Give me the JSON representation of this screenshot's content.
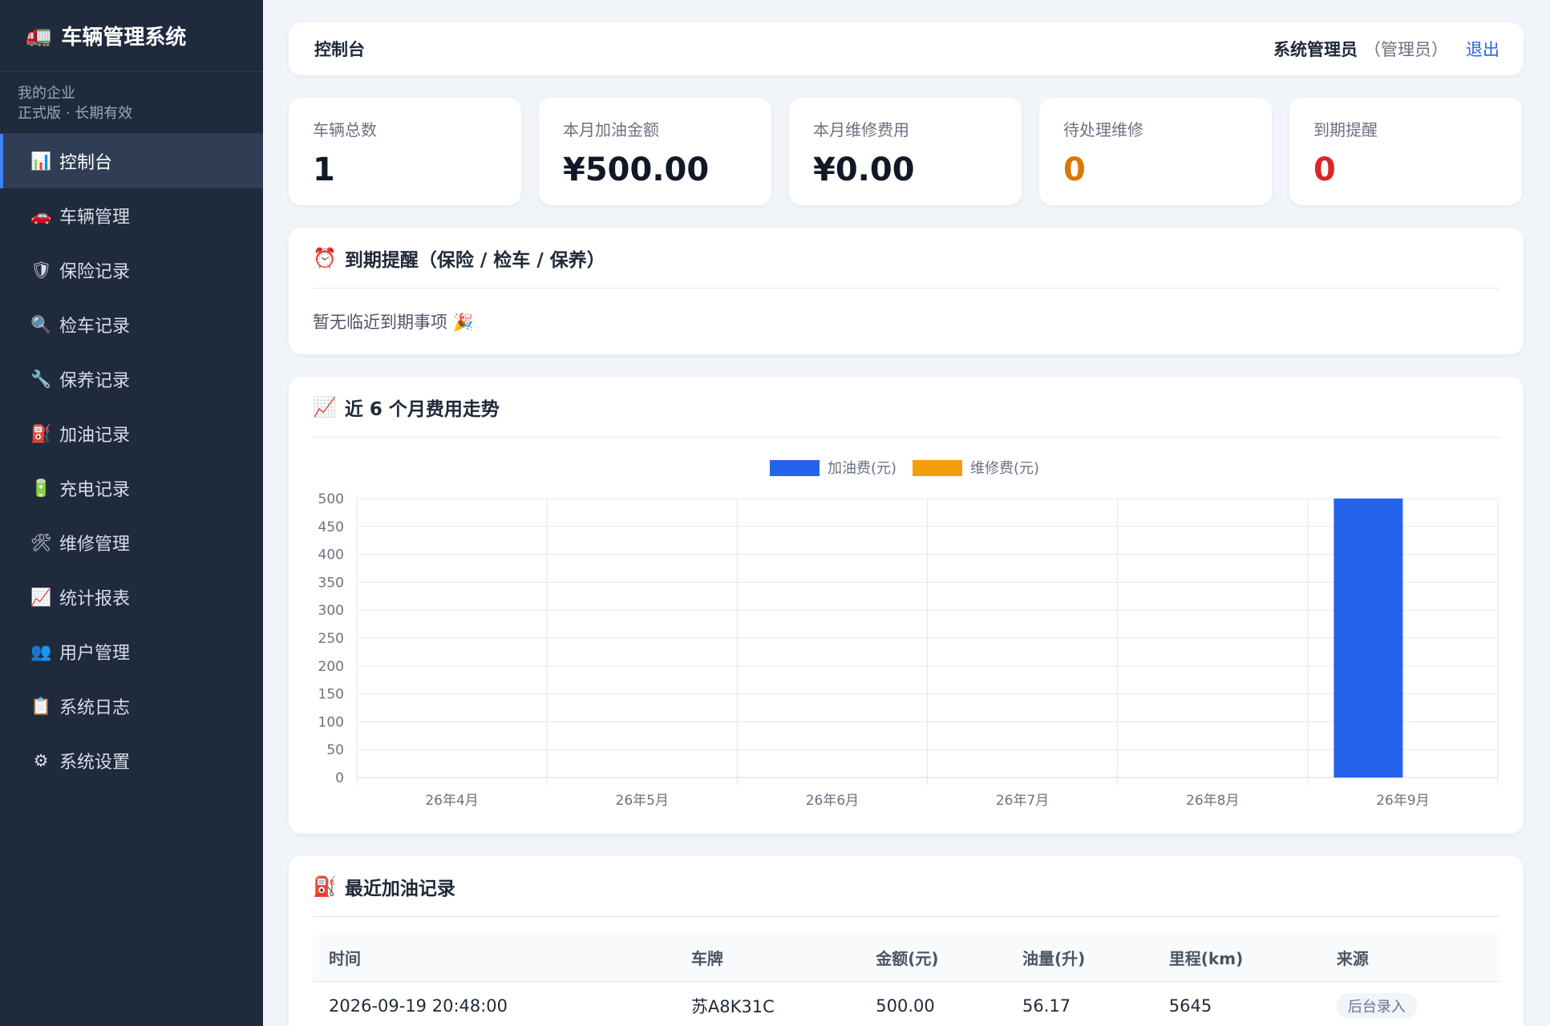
{
  "sidebar": {
    "brand_icon": "🚛",
    "brand_title": "车辆管理系统",
    "org_name": "我的企业",
    "org_plan": "正式版 · 长期有效",
    "items": [
      {
        "icon": "📊",
        "label": "控制台",
        "active": true
      },
      {
        "icon": "🚗",
        "label": "车辆管理"
      },
      {
        "icon": "🛡",
        "label": "保险记录"
      },
      {
        "icon": "🔍",
        "label": "检车记录"
      },
      {
        "icon": "🔧",
        "label": "保养记录"
      },
      {
        "icon": "⛽",
        "label": "加油记录"
      },
      {
        "icon": "🔋",
        "label": "充电记录"
      },
      {
        "icon": "🛠",
        "label": "维修管理"
      },
      {
        "icon": "📈",
        "label": "统计报表"
      },
      {
        "icon": "👥",
        "label": "用户管理"
      },
      {
        "icon": "📋",
        "label": "系统日志"
      },
      {
        "icon": "⚙",
        "label": "系统设置"
      }
    ]
  },
  "header": {
    "title": "控制台",
    "user_name": "系统管理员",
    "user_role": "（管理员）",
    "logout_label": "退出"
  },
  "stats": [
    {
      "label": "车辆总数",
      "value": "1"
    },
    {
      "label": "本月加油金额",
      "value": "¥500.00"
    },
    {
      "label": "本月维修费用",
      "value": "¥0.00"
    },
    {
      "label": "待处理维修",
      "value": "0",
      "color": "#d97706"
    },
    {
      "label": "到期提醒",
      "value": "0",
      "color": "#dc2626"
    }
  ],
  "reminder": {
    "icon": "⏰",
    "title": "到期提醒（保险 / 检车 / 保养）",
    "empty_text": "暂无临近到期事项 🎉"
  },
  "trend": {
    "icon": "📈",
    "title": "近 6 个月费用走势"
  },
  "chart_data": {
    "type": "bar",
    "categories": [
      "26年4月",
      "26年5月",
      "26年6月",
      "26年7月",
      "26年8月",
      "26年9月"
    ],
    "series": [
      {
        "name": "加油费(元)",
        "color": "#2563eb",
        "values": [
          0,
          0,
          0,
          0,
          0,
          500
        ]
      },
      {
        "name": "维修费(元)",
        "color": "#f59e0b",
        "values": [
          0,
          0,
          0,
          0,
          0,
          0
        ]
      }
    ],
    "ylim": [
      0,
      500
    ],
    "yticks": [
      0,
      50,
      100,
      150,
      200,
      250,
      300,
      350,
      400,
      450,
      500
    ],
    "grid": true,
    "legend": "top-center"
  },
  "recent_fuel": {
    "icon": "⛽",
    "title": "最近加油记录",
    "columns": [
      "时间",
      "车牌",
      "金额(元)",
      "油量(升)",
      "里程(km)",
      "来源"
    ],
    "rows": [
      {
        "time": "2026-09-19 20:48:00",
        "plate": "苏A8K31C",
        "amount": "500.00",
        "volume": "56.17",
        "mileage": "5645",
        "source": "后台录入"
      }
    ]
  }
}
